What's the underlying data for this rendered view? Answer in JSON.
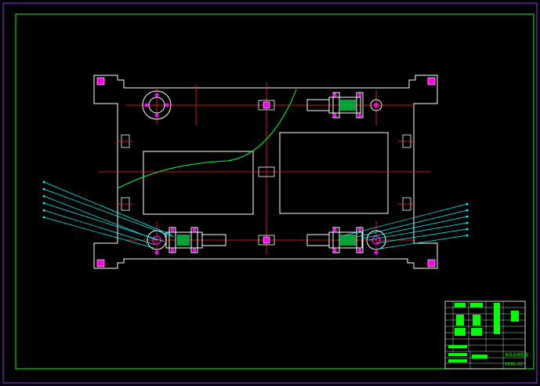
{
  "drawing": {
    "kind": "CAD fixture assembly drawing",
    "background": "#000000",
    "colors": {
      "outer_border": "#9b30ff",
      "inner_border": "#00ff00",
      "outline": "#ffffff",
      "centerline": "#ff2020",
      "bolt": "#ff00ff",
      "leader": "#00ffff",
      "break_line": "#00ff40",
      "title_block_line": "#ffffff",
      "title_block_text": "#00ff00"
    },
    "balloon_count_left": 6,
    "balloon_count_right": 6
  },
  "title_block": {
    "drawing_number": "XZJG-22",
    "caption": "夹具总装配图",
    "table_rows": 10
  }
}
